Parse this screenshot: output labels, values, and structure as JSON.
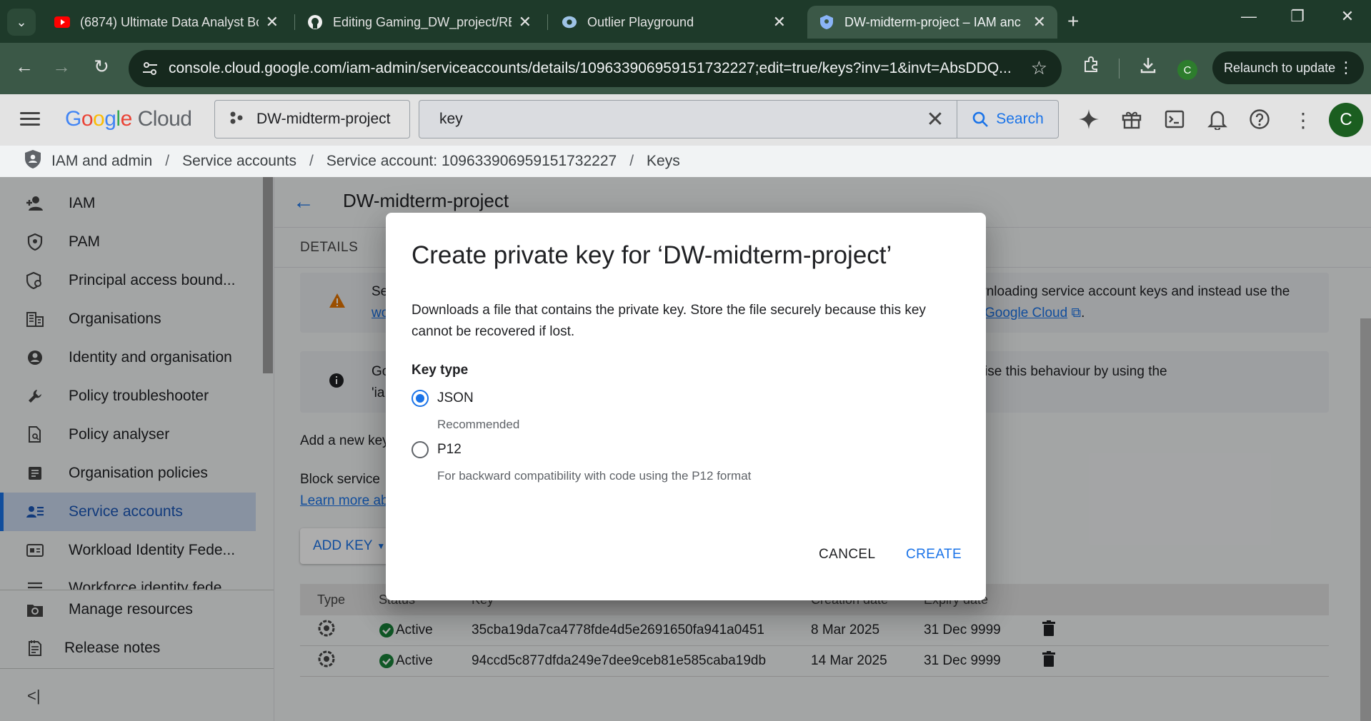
{
  "browser": {
    "tabs": [
      {
        "title": "(6874) Ultimate Data Analyst Bo",
        "icon": "youtube-icon"
      },
      {
        "title": "Editing Gaming_DW_project/RE",
        "icon": "github-icon"
      },
      {
        "title": "Outlier Playground",
        "icon": "outlier-icon"
      },
      {
        "title": "DW-midterm-project – IAM anc",
        "icon": "gcp-shield-icon"
      }
    ],
    "url": "console.cloud.google.com/iam-admin/serviceaccounts/details/109633906959151732227;edit=true/keys?inv=1&invt=AbsDDQ...",
    "profile_initial": "C",
    "relaunch_label": "Relaunch to update"
  },
  "gcp_header": {
    "logo_google": "Google",
    "logo_cloud": "Cloud",
    "project": "DW-midterm-project",
    "search_value": "key",
    "search_button": "Search",
    "avatar_initial": "C"
  },
  "breadcrumb": {
    "items": [
      "IAM and admin",
      "Service accounts",
      "Service account: 109633906959151732227",
      "Keys"
    ],
    "separator": "/"
  },
  "sidebar": {
    "items": [
      {
        "label": "IAM",
        "icon": "person-add-icon"
      },
      {
        "label": "PAM",
        "icon": "shield-icon"
      },
      {
        "label": "Principal access bound...",
        "icon": "policy-shield-icon"
      },
      {
        "label": "Organisations",
        "icon": "building-icon"
      },
      {
        "label": "Identity and organisation",
        "icon": "account-circle-icon"
      },
      {
        "label": "Policy troubleshooter",
        "icon": "wrench-icon"
      },
      {
        "label": "Policy analyser",
        "icon": "document-search-icon"
      },
      {
        "label": "Organisation policies",
        "icon": "list-doc-icon"
      },
      {
        "label": "Service accounts",
        "icon": "service-account-icon"
      },
      {
        "label": "Workload Identity Fede...",
        "icon": "id-card-icon"
      },
      {
        "label": "Workforce identity fede",
        "icon": "list-icon"
      }
    ],
    "footer_items": [
      {
        "label": "Manage resources",
        "icon": "gear-box-icon"
      },
      {
        "label": "Release notes",
        "icon": "notes-icon"
      }
    ],
    "active_index": 8
  },
  "main": {
    "title": "DW-midterm-project",
    "details_tab": "DETAILS",
    "alert1": {
      "left": "Se",
      "left2": "wo",
      "right": "wnloading service account keys and instead use the",
      "right_link": "Google Cloud",
      "right_end": "."
    },
    "alert2": {
      "left": "Go",
      "left2": "'ia",
      "right": "ise this behaviour by using the"
    },
    "add_new_key": "Add a new key",
    "block_service": "Block service",
    "learn_more": "Learn more ab",
    "add_key_btn": "ADD KEY",
    "table": {
      "headers": [
        "Type",
        "Status",
        "Key",
        "Creation date",
        "Expiry date"
      ],
      "rows": [
        {
          "status": "Active",
          "key": "35cba19da7ca4778fde4d5e2691650fa941a0451",
          "created": "8 Mar 2025",
          "expires": "31 Dec 9999"
        },
        {
          "status": "Active",
          "key": "94ccd5c877dfda249e7dee9ceb81e585caba19db",
          "created": "14 Mar 2025",
          "expires": "31 Dec 9999"
        }
      ]
    }
  },
  "dialog": {
    "title": "Create private key for ‘DW-midterm-project’",
    "description": "Downloads a file that contains the private key. Store the file securely because this key cannot be recovered if lost.",
    "key_type_label": "Key type",
    "options": [
      {
        "label": "JSON",
        "sub": "Recommended",
        "checked": true
      },
      {
        "label": "P12",
        "sub": "For backward compatibility with code using the P12 format",
        "checked": false
      }
    ],
    "cancel": "CANCEL",
    "create": "CREATE"
  }
}
